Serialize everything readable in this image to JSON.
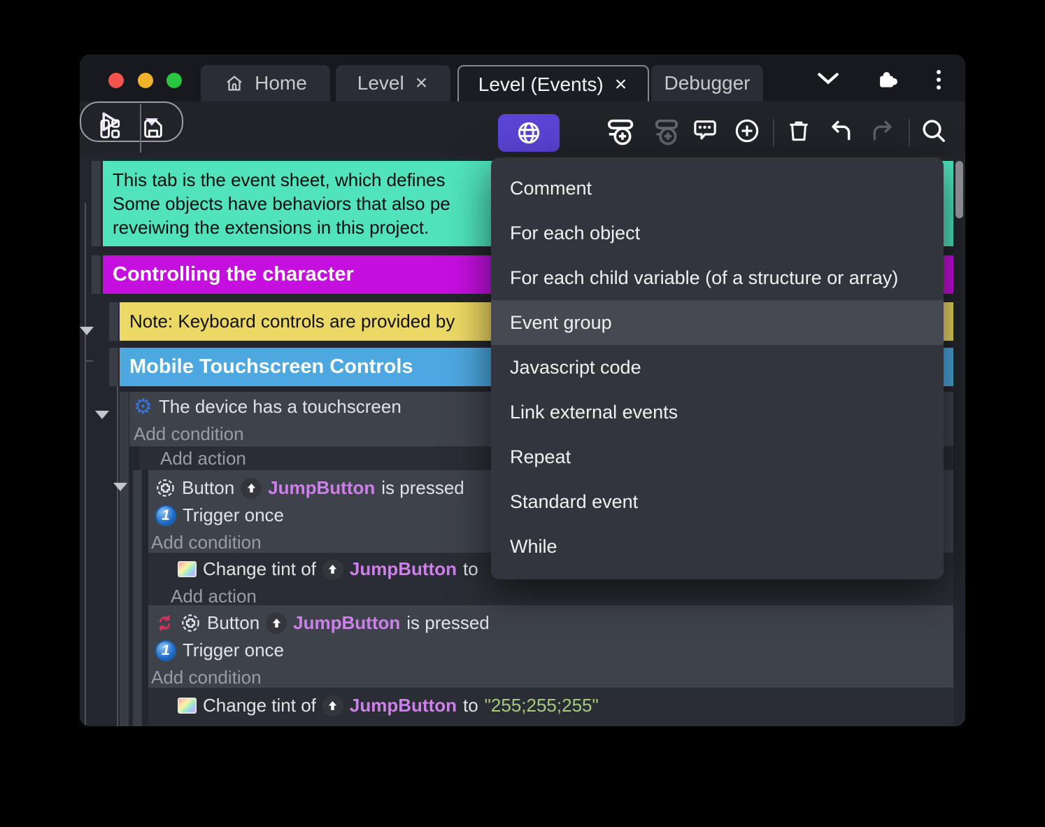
{
  "titlebar": {
    "tabs": [
      {
        "label": "Home"
      },
      {
        "label": "Level"
      },
      {
        "label": "Level (Events)"
      },
      {
        "label": "Debugger"
      }
    ]
  },
  "glyphs": {
    "close": "×",
    "gear": "⚙",
    "kebab_dot": "•",
    "one": "1"
  },
  "menu": {
    "items": [
      "Comment",
      "For each object",
      "For each child variable (of a structure or array)",
      "Event group",
      "Javascript code",
      "Link external events",
      "Repeat",
      "Standard event",
      "While"
    ],
    "highlighted": "Event group"
  },
  "sheet": {
    "comment": {
      "line1": "This tab is the event sheet, which defines",
      "line2": "Some objects have behaviors that also pe",
      "line3": "reveiwing the extensions in this project."
    },
    "group_controlling": "Controlling the character",
    "note": "Note: Keyboard controls are provided by",
    "group_mobile": "Mobile Touchscreen Controls",
    "condition_touchscreen": "The device has a touchscreen",
    "add_condition": "Add condition",
    "add_action": "Add action",
    "button_word": "Button",
    "object_name": "JumpButton",
    "is_pressed": "is pressed",
    "trigger_once": "Trigger once",
    "change_tint_of": "Change tint of",
    "to_word": "to",
    "tint_value": "\"255;255;255\""
  },
  "colors": {
    "accent_purple": "#5b43d4",
    "comment_teal": "#50e3bc",
    "group_magenta": "#c50fdf",
    "note_yellow": "#ecd965",
    "group_blue": "#4da7e0",
    "object_text": "#cd80ea",
    "string_value": "#a7cb7e",
    "traffic_red": "#f4544e",
    "traffic_yellow": "#f0b32a",
    "traffic_green": "#29c740"
  }
}
